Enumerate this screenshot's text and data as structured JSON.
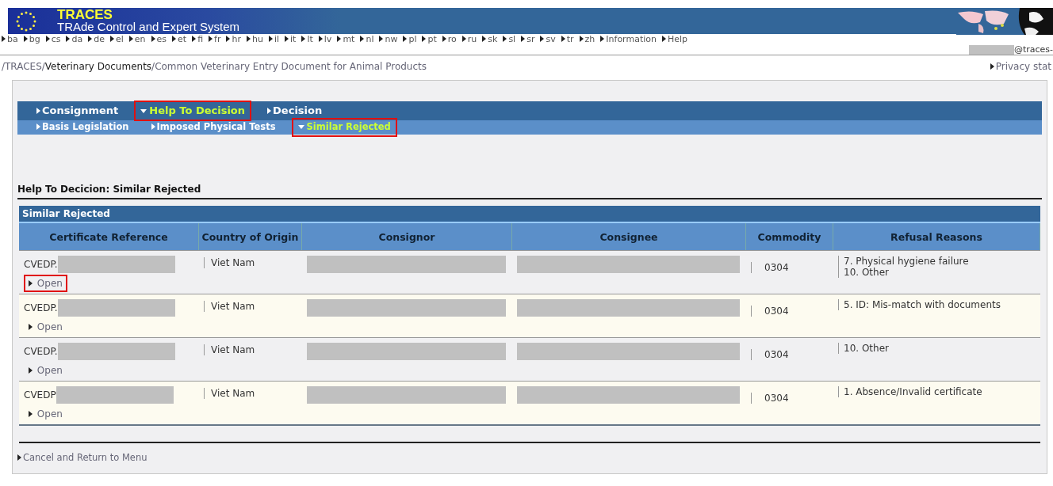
{
  "header": {
    "title": "TRACES",
    "subtitle": "TRAde Control and Expert System"
  },
  "languages": [
    "ba",
    "bg",
    "cs",
    "da",
    "de",
    "el",
    "en",
    "es",
    "et",
    "fi",
    "fr",
    "hr",
    "hu",
    "il",
    "it",
    "lt",
    "lv",
    "mt",
    "nl",
    "nw",
    "pl",
    "pt",
    "ro",
    "ru",
    "sk",
    "sl",
    "sr",
    "sv",
    "tr",
    "zh",
    "Information",
    "Help"
  ],
  "user": {
    "redacted": true,
    "email": "@traces-"
  },
  "breadcrumb": [
    {
      "label": "/TRACES/",
      "kind": "link"
    },
    {
      "label": "Veterinary Documents",
      "kind": "current"
    },
    {
      "label": "/Common Veterinary Entry Document for Animal Products",
      "kind": "link"
    }
  ],
  "privacy_link": "Privacy stat",
  "tabs": [
    {
      "label": "Consignment",
      "selected": false,
      "annotated": false
    },
    {
      "label": "Help To Decision",
      "selected": true,
      "annotated": true
    },
    {
      "label": "Decision",
      "selected": false,
      "annotated": false
    }
  ],
  "subtabs": [
    {
      "label": "Basis Legislation",
      "selected": false,
      "annotated": false
    },
    {
      "label": "Imposed Physical Tests",
      "selected": false,
      "annotated": false
    },
    {
      "label": "Similar Rejected",
      "selected": true,
      "annotated": true
    }
  ],
  "page_title": "Help To Decicion: Similar Rejected",
  "table": {
    "title": "Similar Rejected",
    "columns": [
      "Certificate Reference",
      "Country of Origin",
      "Consignor",
      "Consignee",
      "Commodity",
      "Refusal Reasons"
    ],
    "rows": [
      {
        "reference": "CVEDP.",
        "reference_redacted": true,
        "open": "Open",
        "open_annotated": true,
        "country": "Viet Nam",
        "consignor_redacted": true,
        "consignee_redacted": true,
        "commodity": "0304",
        "reasons": [
          "7. Physical hygiene failure",
          "10. Other"
        ]
      },
      {
        "reference": "CVEDP.",
        "reference_redacted": true,
        "open": "Open",
        "open_annotated": false,
        "country": "Viet Nam",
        "consignor_redacted": true,
        "consignee_redacted": true,
        "commodity": "0304",
        "reasons": [
          "5. ID: Mis-match with documents"
        ]
      },
      {
        "reference": "CVEDP.",
        "reference_redacted": true,
        "open": "Open",
        "open_annotated": false,
        "country": "Viet Nam",
        "consignor_redacted": true,
        "consignee_redacted": true,
        "commodity": "0304",
        "reasons": [
          "10. Other"
        ]
      },
      {
        "reference": "CVEDP",
        "reference_redacted": true,
        "open": "Open",
        "open_annotated": false,
        "country": "Viet Nam",
        "consignor_redacted": true,
        "consignee_redacted": true,
        "commodity": "0304",
        "reasons": [
          "1. Absence/Invalid certificate"
        ]
      }
    ]
  },
  "cancel_link": "Cancel and Return to Menu"
}
